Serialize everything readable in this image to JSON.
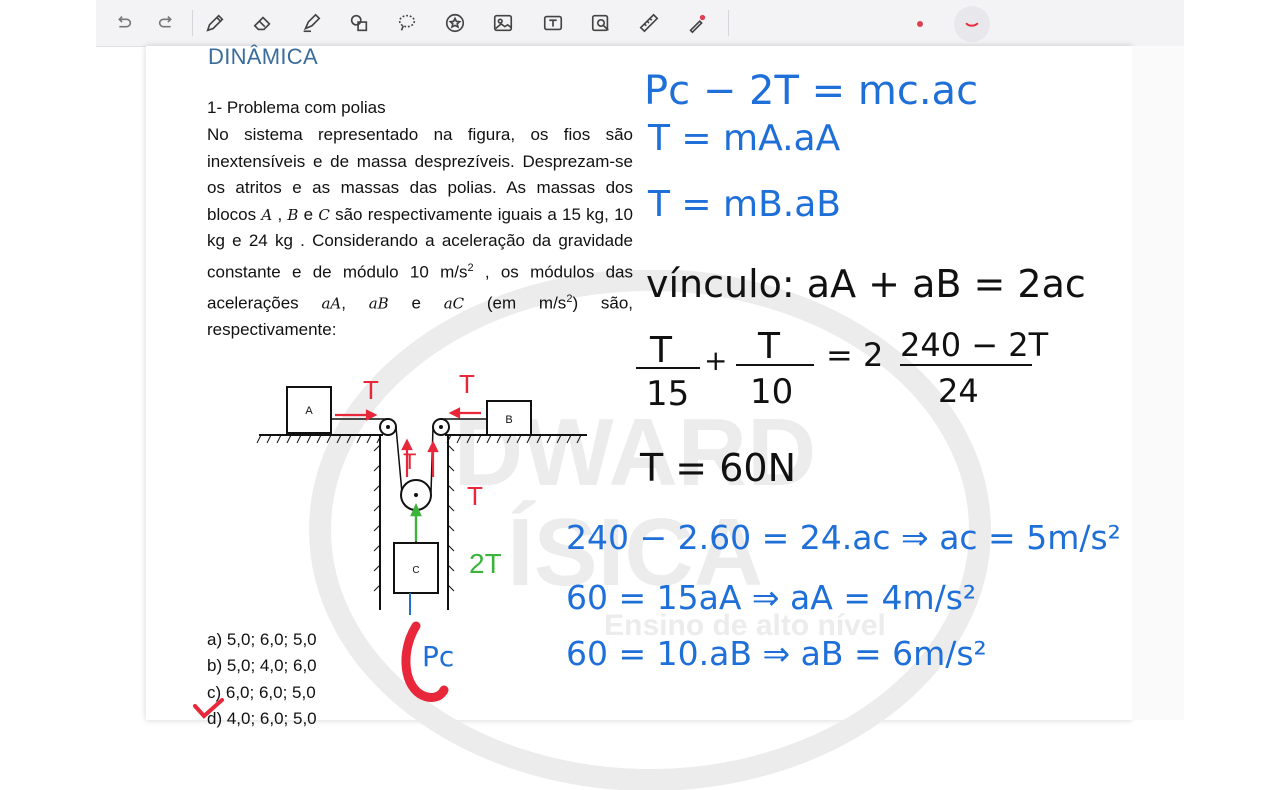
{
  "toolbar": {
    "items": [
      "undo-icon",
      "redo-icon",
      "pen-icon",
      "eraser-icon",
      "highlighter-icon",
      "shapes-icon",
      "lasso-icon",
      "sticker-icon",
      "image-icon",
      "text-box-icon",
      "image-search-icon",
      "ruler-icon",
      "laser-pointer-icon"
    ]
  },
  "document": {
    "heading": "DINÂMICA",
    "problem_title": "1-   Problema com polias",
    "body_text_1": "No sistema representado na figura, os fios são inextensíveis e de massa desprezíveis. Desprezam-se os atritos e as massas das polias. As massas dos blocos ",
    "var_A": "A",
    "sep_1": " , ",
    "var_B": "B",
    "sep_2": " e ",
    "var_C": "C",
    "body_text_2": " são respectivamente iguais a 15 kg, 10 kg e 24 kg . Considerando a aceleração da gravidade constante e de módulo 10 m/s",
    "sup_2": "2",
    "body_text_3": " , os módulos das acelerações ",
    "var_aA": "aA",
    "sep_3": ", ",
    "var_aB": "aB",
    "sep_4": " e ",
    "var_aC": "aC",
    "body_text_4": "   (em   m/s",
    "sup_3": "2",
    "body_text_5": ")   são, respectivamente:",
    "options": [
      {
        "label": "a)  5,0; 6,0; 5,0"
      },
      {
        "label": "b)  5,0; 4,0; 6,0"
      },
      {
        "label": "c)  6,0; 6,0; 5,0"
      },
      {
        "label": "d)  4,0; 6,0; 5,0"
      }
    ]
  },
  "figure": {
    "block_a": "A",
    "block_b": "B",
    "block_c": "C",
    "tension_labels": [
      "T",
      "T",
      "T",
      "T"
    ],
    "two_t": "2T",
    "weight_label": "Pc"
  },
  "handwriting": {
    "eq1": "Pc − 2T = mc.ac",
    "eq2": "T = mA.aA",
    "eq3": "T = mB.aB",
    "vinculo": "vínculo:  aA + aB = 2ac",
    "frac1_num": "T",
    "frac1_den": "15",
    "plus": "+",
    "frac2_num": "T",
    "frac2_den": "10",
    "equals_two": "= 2",
    "frac3_num": "240 − 2T",
    "frac3_den": "24",
    "result_t": "T = 60N",
    "line1": "240 − 2.60 = 24.ac ⇒ ac = 5m/s²",
    "line2": "60 = 15aA ⇒  aA = 4m/s²",
    "line3": "60 = 10.aB ⇒ aB = 6m/s²"
  },
  "watermark": {
    "line1": "DWARD",
    "line2": "ÍSICA",
    "tagline": "Ensino de alto nível"
  },
  "colors": {
    "ink_blue": "#1f6fd8",
    "ink_red": "#e8283a",
    "ink_green": "#3cb43c",
    "heading": "#3b6d9c"
  }
}
